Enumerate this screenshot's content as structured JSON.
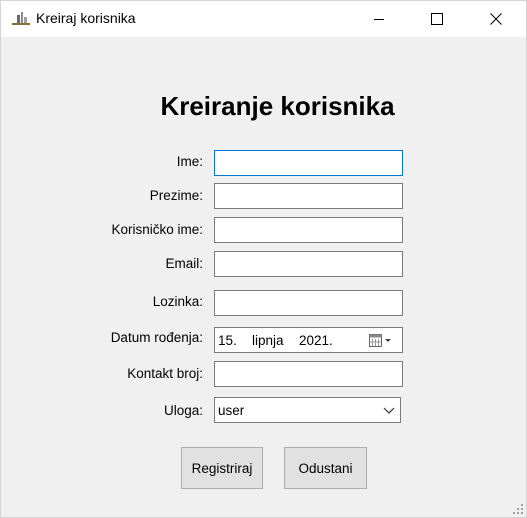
{
  "window": {
    "title": "Kreiraj korisnika",
    "icon": "app-window-icon"
  },
  "form": {
    "heading": "Kreiranje korisnika",
    "fields": {
      "ime": {
        "label": "Ime:",
        "value": ""
      },
      "prezime": {
        "label": "Prezime:",
        "value": ""
      },
      "korisnicko_ime": {
        "label": "Korisničko ime:",
        "value": ""
      },
      "email": {
        "label": "Email:",
        "value": ""
      },
      "lozinka": {
        "label": "Lozinka:",
        "value": ""
      },
      "datum_rodjenja": {
        "label": "Datum rođenja:",
        "day": "15.",
        "month": "lipnja",
        "year": "2021."
      },
      "kontakt_broj": {
        "label": "Kontakt broj:",
        "value": ""
      },
      "uloga": {
        "label": "Uloga:",
        "selected": "user"
      }
    },
    "buttons": {
      "register": "Registriraj",
      "cancel": "Odustani"
    }
  },
  "colors": {
    "window_bg": "#f0f0f0",
    "titlebar_bg": "#ffffff",
    "focus_border": "#0078d7",
    "button_bg": "#e1e1e1"
  }
}
